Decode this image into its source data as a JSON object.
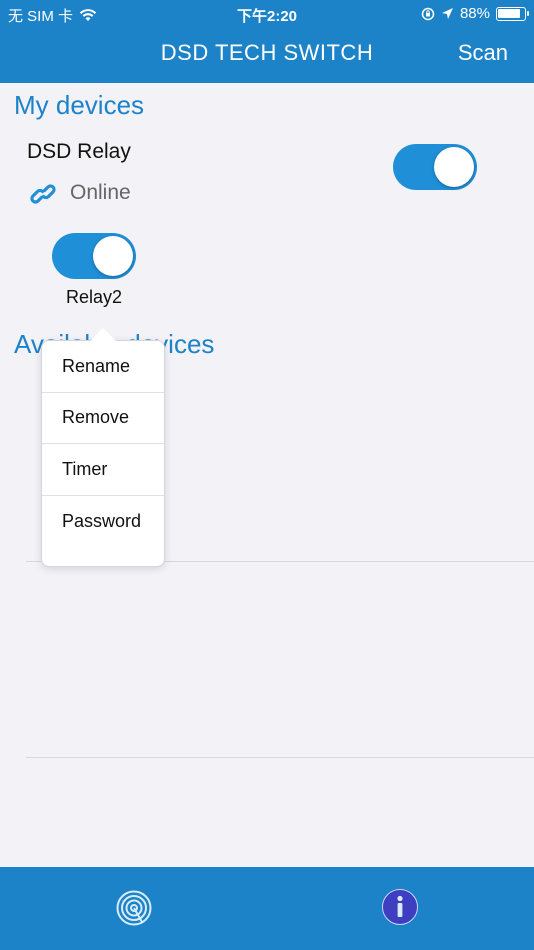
{
  "status_bar": {
    "carrier": "无 SIM 卡",
    "time": "下午2:20",
    "battery_percent": "88%",
    "battery_level": 0.88
  },
  "nav": {
    "title": "DSD TECH SWITCH",
    "scan_label": "Scan"
  },
  "my_devices": {
    "section_title": "My devices",
    "device": {
      "name": "DSD Relay",
      "status": "Online",
      "main_switch_on": true,
      "relay": {
        "label": "Relay2",
        "on": true
      }
    }
  },
  "available_devices": {
    "section_title": "Available devices"
  },
  "context_menu": {
    "items": [
      {
        "label": "Rename"
      },
      {
        "label": "Remove"
      },
      {
        "label": "Timer"
      },
      {
        "label": "Password"
      }
    ]
  },
  "tabbar": {
    "tabs": [
      {
        "icon": "broadcast-icon"
      },
      {
        "icon": "info-icon"
      }
    ]
  },
  "colors": {
    "brand": "#1d83c9",
    "toggle_on": "#1f8fd8",
    "info_icon": "#3d3ec0"
  }
}
